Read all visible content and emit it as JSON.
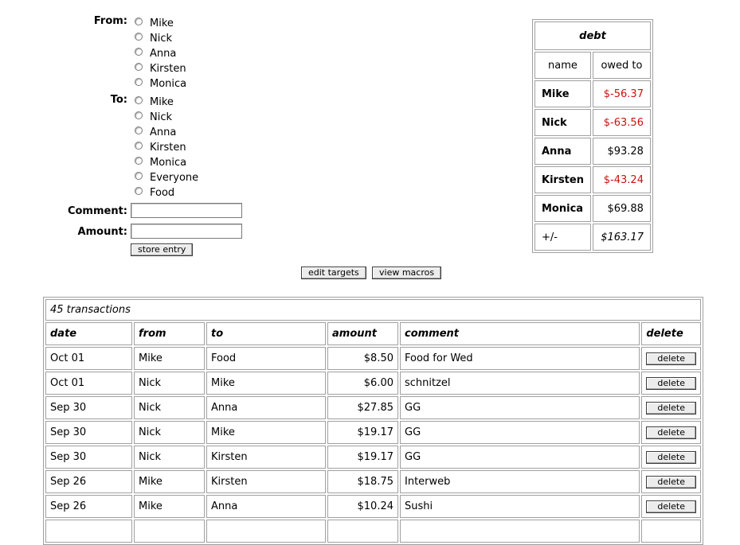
{
  "form": {
    "from_label": "From:",
    "to_label": "To:",
    "comment_label": "Comment:",
    "amount_label": "Amount:",
    "comment_value": "",
    "amount_value": "",
    "from_options": [
      "Mike",
      "Nick",
      "Anna",
      "Kirsten",
      "Monica"
    ],
    "to_options": [
      "Mike",
      "Nick",
      "Anna",
      "Kirsten",
      "Monica",
      "Everyone",
      "Food"
    ],
    "store_label": "store entry"
  },
  "actions": {
    "edit_targets": "edit targets",
    "view_macros": "view macros"
  },
  "debt": {
    "title": "debt",
    "col_name": "name",
    "col_owed": "owed to",
    "rows": [
      {
        "name": "Mike",
        "amount": "$-56.37",
        "negative": true
      },
      {
        "name": "Nick",
        "amount": "$-63.56",
        "negative": true
      },
      {
        "name": "Anna",
        "amount": "$93.28",
        "negative": false
      },
      {
        "name": "Kirsten",
        "amount": "$-43.24",
        "negative": true
      },
      {
        "name": "Monica",
        "amount": "$69.88",
        "negative": false
      }
    ],
    "total_label": "+/-",
    "total_value": "$163.17",
    "negative_color": "#cc1111"
  },
  "transactions": {
    "caption": "45 transactions",
    "headers": {
      "date": "date",
      "from": "from",
      "to": "to",
      "amount": "amount",
      "comment": "comment",
      "delete": "delete"
    },
    "delete_label": "delete",
    "rows": [
      {
        "date": "Oct 01",
        "from": "Mike",
        "to": "Food",
        "amount": "$8.50",
        "comment": "Food for Wed"
      },
      {
        "date": "Oct 01",
        "from": "Nick",
        "to": "Mike",
        "amount": "$6.00",
        "comment": "schnitzel"
      },
      {
        "date": "Sep 30",
        "from": "Nick",
        "to": "Anna",
        "amount": "$27.85",
        "comment": "GG"
      },
      {
        "date": "Sep 30",
        "from": "Nick",
        "to": "Mike",
        "amount": "$19.17",
        "comment": "GG"
      },
      {
        "date": "Sep 30",
        "from": "Nick",
        "to": "Kirsten",
        "amount": "$19.17",
        "comment": "GG"
      },
      {
        "date": "Sep 26",
        "from": "Mike",
        "to": "Kirsten",
        "amount": "$18.75",
        "comment": "Interweb"
      },
      {
        "date": "Sep 26",
        "from": "Mike",
        "to": "Anna",
        "amount": "$10.24",
        "comment": "Sushi"
      },
      {
        "date": "",
        "from": "",
        "to": "",
        "amount": "",
        "comment": ""
      }
    ]
  }
}
